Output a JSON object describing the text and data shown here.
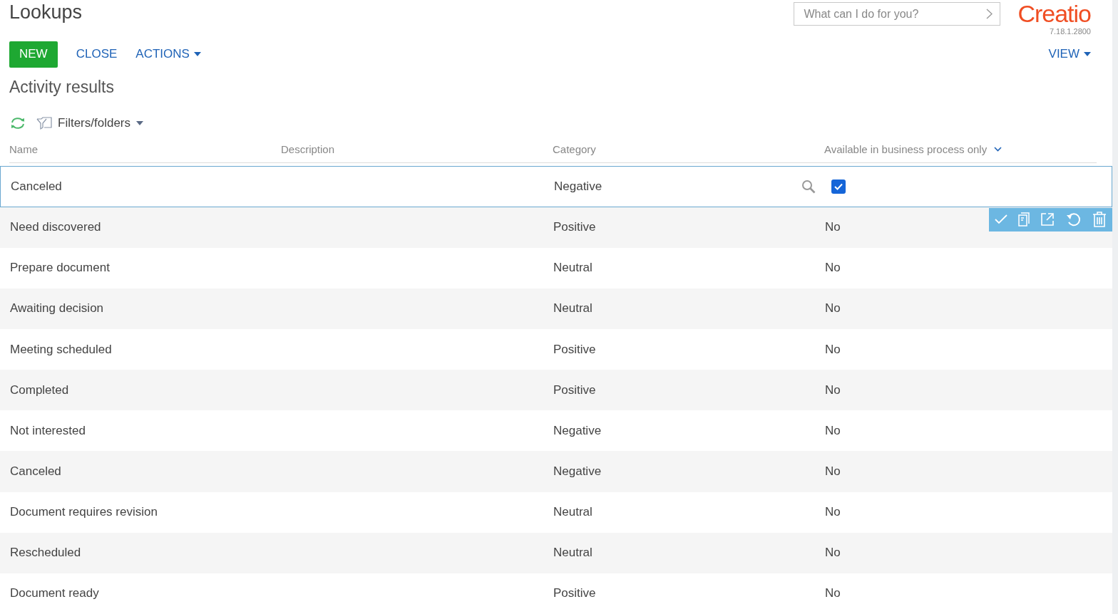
{
  "header": {
    "title": "Lookups",
    "search": {
      "placeholder": "What can I do for you?"
    },
    "logo": "Creatio",
    "version": "7.18.1.2800"
  },
  "actions": [
    {
      "label": "NEW",
      "kind": "primary"
    },
    {
      "label": "CLOSE",
      "kind": "link"
    },
    {
      "label": "ACTIONS",
      "kind": "menu"
    }
  ],
  "view": "VIEW",
  "section_title": "Activity results",
  "filters": "Filters/folders",
  "table": {
    "columns": [
      "Name",
      "Description",
      "Category",
      "Available in business process only"
    ],
    "rows": [
      {
        "name": "Canceled",
        "category": "Negative",
        "editing": true,
        "checked": true
      },
      {
        "name": "Need discovered",
        "category": "Positive",
        "editing": false,
        "value": "No"
      },
      {
        "name": "Prepare document",
        "category": "Neutral",
        "editing": false,
        "value": "No"
      },
      {
        "name": "Awaiting decision",
        "category": "Neutral",
        "editing": false,
        "value": "No"
      },
      {
        "name": "Meeting scheduled",
        "category": "Positive",
        "editing": false,
        "value": "No"
      },
      {
        "name": "Completed",
        "category": "Positive",
        "editing": false,
        "value": "No"
      },
      {
        "name": "Not interested",
        "category": "Negative",
        "editing": false,
        "value": "No"
      },
      {
        "name": "Canceled",
        "category": "Negative",
        "editing": false,
        "value": "No"
      },
      {
        "name": "Document requires revision",
        "category": "Neutral",
        "editing": false,
        "value": "No"
      },
      {
        "name": "Rescheduled",
        "category": "Neutral",
        "editing": false,
        "value": "No"
      },
      {
        "name": "Document ready",
        "category": "Positive",
        "editing": false,
        "value": "No"
      }
    ]
  }
}
